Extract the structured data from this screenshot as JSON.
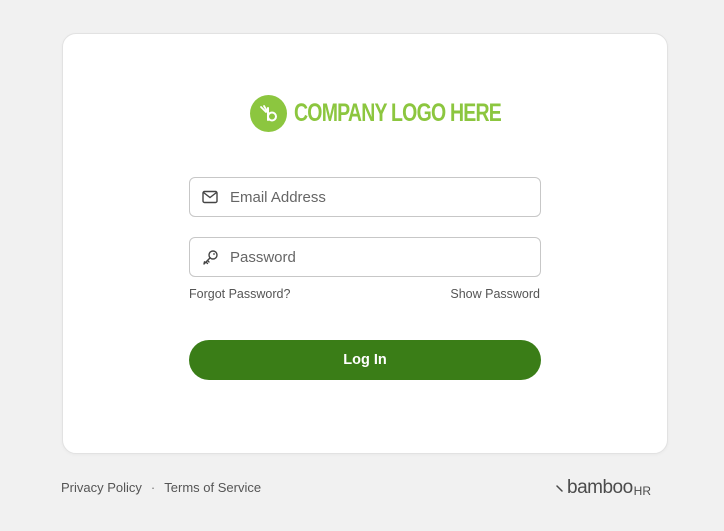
{
  "logo": {
    "text": "COMPANY LOGO HERE",
    "icon": "bamboo-b-icon",
    "color": "#8cc63f"
  },
  "form": {
    "email_placeholder": "Email Address",
    "email_value": "",
    "email_icon": "envelope-icon",
    "password_placeholder": "Password",
    "password_value": "",
    "password_icon": "key-icon",
    "forgot_label": "Forgot Password?",
    "show_password_label": "Show Password",
    "login_label": "Log In",
    "login_color": "#3a7d17"
  },
  "footer": {
    "privacy_label": "Privacy Policy",
    "separator": "·",
    "terms_label": "Terms of Service",
    "brand_name": "bamboo",
    "brand_suffix": "HR"
  }
}
